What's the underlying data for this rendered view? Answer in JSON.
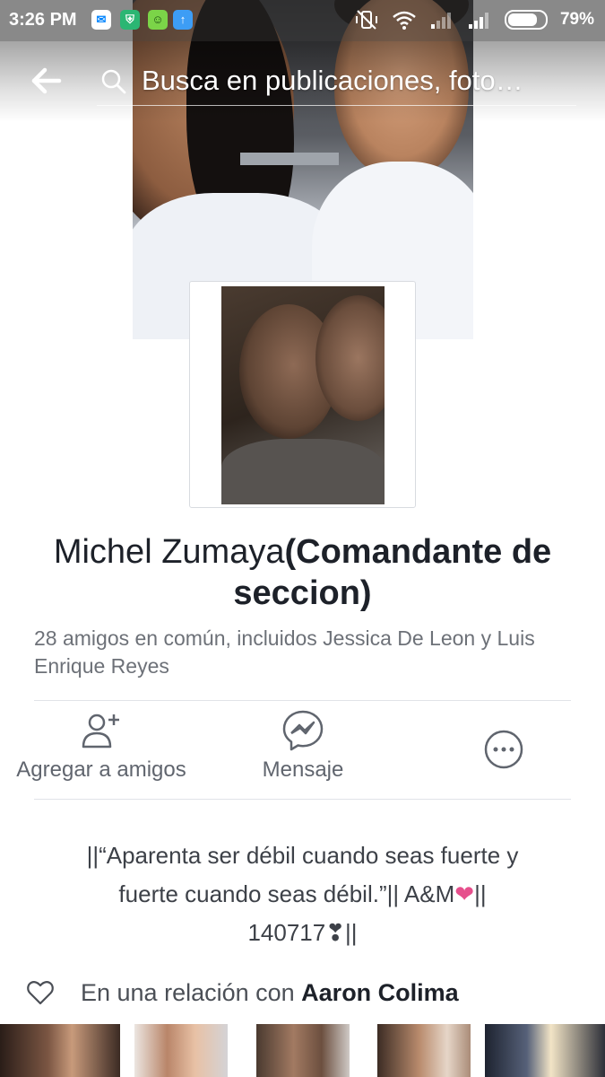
{
  "status_bar": {
    "time": "3:26 PM",
    "battery_percent": "79%",
    "battery_level": 0.79,
    "notification_icons": [
      "messenger-icon",
      "shield-app-icon",
      "cat-app-icon",
      "upload-icon"
    ],
    "system_icons": [
      "vibrate-off-icon",
      "wifi-icon",
      "signal-weak-icon",
      "signal-icon",
      "battery-icon"
    ]
  },
  "nav": {
    "back_icon": "arrow-left-icon",
    "search_placeholder": "Busca en publicaciones, foto…"
  },
  "profile": {
    "name": "Michel Zumaya",
    "nickname": "(Comandante de seccion)",
    "mutual_friends": "28 amigos en común, incluidos Jessica De Leon y Luis Enrique Reyes"
  },
  "actions": {
    "add_friend_label": "Agregar a amigos",
    "message_label": "Mensaje",
    "more_icon": "more-options-icon"
  },
  "bio": {
    "line1": "||“Aparenta ser débil cuando seas fuerte y",
    "line2a": "fuerte cuando seas débil.”|| A&M",
    "heart": "❤",
    "line2b": "||",
    "line3a": "140717",
    "line3_symbol": "❣",
    "line3b": "||"
  },
  "relationship": {
    "prefix": "En una relación con ",
    "partner": "Aaron Colima"
  },
  "colors": {
    "text_primary": "#1d2129",
    "text_secondary": "#6d7178",
    "icon_gray": "#60656e",
    "heart_pink": "#e64f8c",
    "divider": "#e1e3e8"
  }
}
